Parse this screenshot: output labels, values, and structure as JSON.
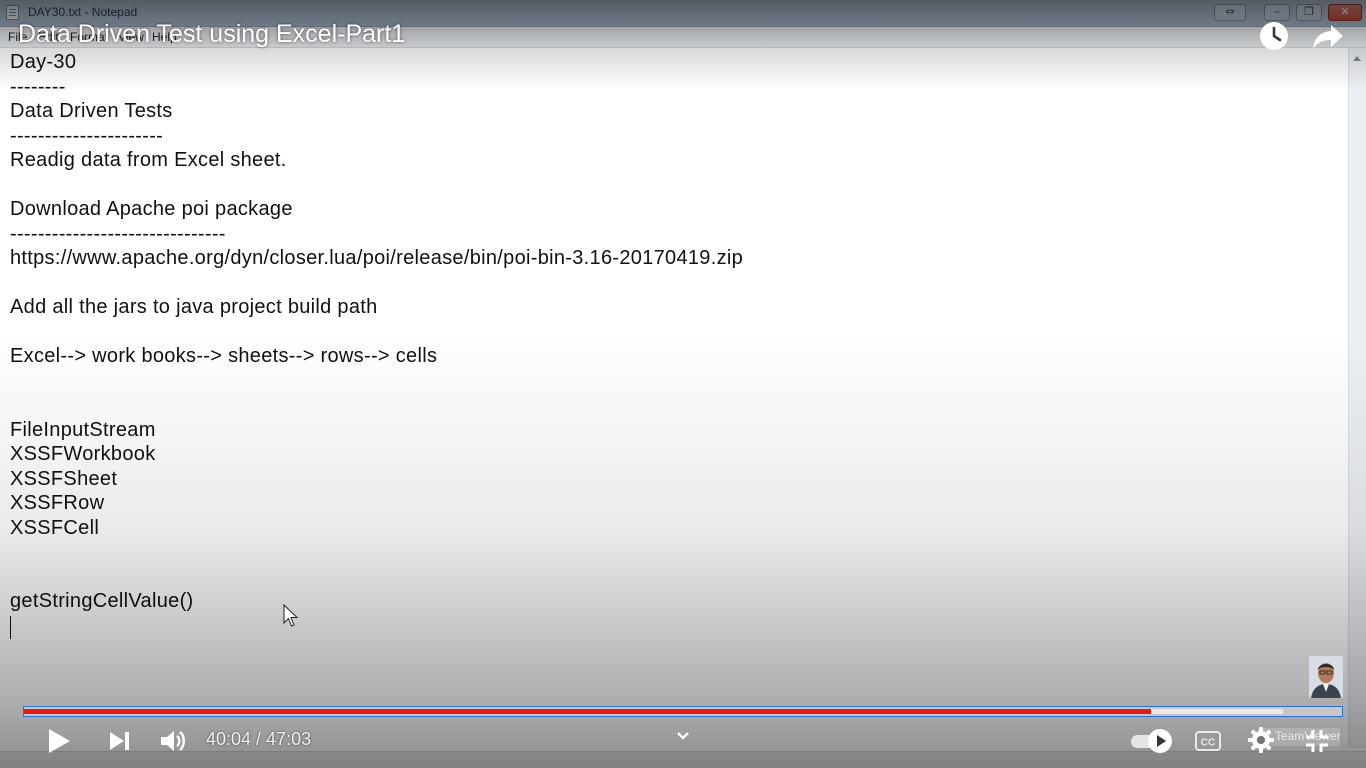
{
  "notepad": {
    "window_title": "DAY30.txt - Notepad",
    "menu": [
      "File",
      "Edit",
      "Format",
      "View",
      "Help"
    ],
    "lines": [
      "Day-30",
      "--------",
      "Data Driven Tests",
      "----------------------",
      "Readig data from Excel sheet.",
      "",
      "Download Apache poi package",
      "-------------------------------",
      "https://www.apache.org/dyn/closer.lua/poi/release/bin/poi-bin-3.16-20170419.zip",
      "",
      "Add all the jars to java project build path",
      "",
      "Excel--> work books--> sheets--> rows--> cells",
      "",
      "",
      "FileInputStream",
      "XSSFWorkbook",
      "XSSFSheet",
      "XSSFRow",
      "XSSFCell",
      "",
      "",
      "getStringCellValue()"
    ]
  },
  "player": {
    "video_title": "Data Driven Test using Excel-Part1",
    "time": "40:04 / 47:03",
    "progress_played": 0.855,
    "progress_buffered": 0.955,
    "watermark": "TeamViewer",
    "icons": {
      "watch_later": "clock-icon",
      "share": "share-arrow-icon",
      "play": "play-icon",
      "next": "skip-next-icon",
      "volume": "volume-icon",
      "chevron": "chevron-down-icon",
      "autoplay": "autoplay-toggle-icon",
      "cc": "closed-captions-icon",
      "settings": "gear-icon",
      "exit_fullscreen": "exit-fullscreen-icon"
    },
    "colors": {
      "played": "#e21b1b",
      "buffer": "#ebebeb",
      "focus_outline": "#2a72d6"
    }
  }
}
